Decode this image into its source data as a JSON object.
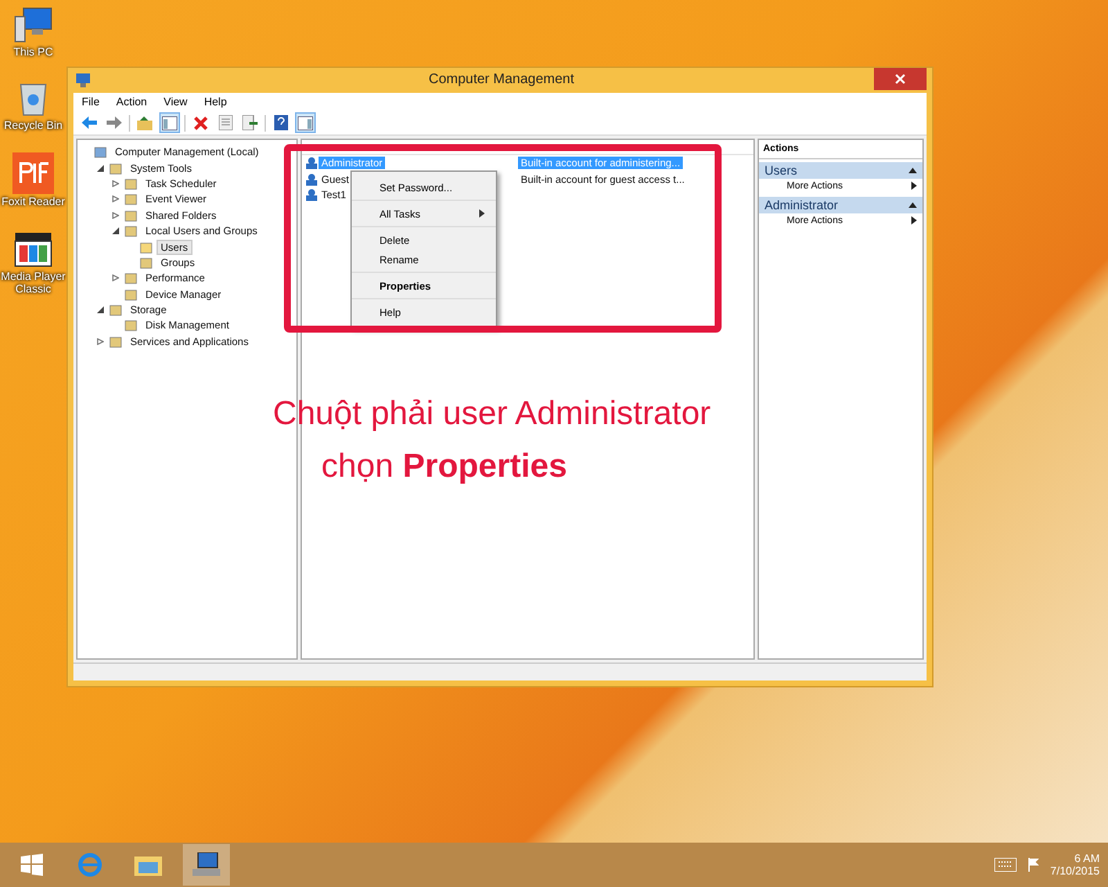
{
  "desktop_icons": [
    {
      "kind": "computer",
      "label": "This PC"
    },
    {
      "kind": "bin",
      "label": "Recycle Bin"
    },
    {
      "kind": "pdf",
      "label": "Foxit Reader"
    },
    {
      "kind": "media",
      "label": "Media Player Classic"
    }
  ],
  "window": {
    "title": "Computer Management",
    "menu": [
      "File",
      "Action",
      "View",
      "Help"
    ],
    "toolbar": [
      {
        "kind": "back",
        "pressed": false
      },
      {
        "kind": "forward",
        "pressed": false
      },
      {
        "kind": "sep",
        "pressed": false
      },
      {
        "kind": "up",
        "pressed": false
      },
      {
        "kind": "tree",
        "pressed": true
      },
      {
        "kind": "sep",
        "pressed": false
      },
      {
        "kind": "delete",
        "pressed": false
      },
      {
        "kind": "props",
        "pressed": false
      },
      {
        "kind": "export",
        "pressed": false
      },
      {
        "kind": "sep",
        "pressed": false
      },
      {
        "kind": "help",
        "pressed": false
      },
      {
        "kind": "pane",
        "pressed": true
      }
    ],
    "tree": [
      {
        "label": "Computer Management (Local)",
        "selected": false,
        "children": [
          {
            "label": "System Tools",
            "expanded": true,
            "selected": false,
            "children": [
              {
                "label": "Task Scheduler",
                "expanded": false,
                "selected": false
              },
              {
                "label": "Event Viewer",
                "expanded": false,
                "selected": false
              },
              {
                "label": "Shared Folders",
                "expanded": false,
                "selected": false
              },
              {
                "label": "Local Users and Groups",
                "expanded": true,
                "selected": false,
                "children": [
                  {
                    "label": "Users",
                    "selected": true
                  },
                  {
                    "label": "Groups",
                    "selected": false
                  }
                ]
              },
              {
                "label": "Performance",
                "expanded": false,
                "selected": false
              },
              {
                "label": "Device Manager",
                "selected": false
              }
            ]
          },
          {
            "label": "Storage",
            "expanded": true,
            "selected": false,
            "children": [
              {
                "label": "Disk Management",
                "selected": false
              }
            ]
          },
          {
            "label": "Services and Applications",
            "expanded": false,
            "selected": false
          }
        ]
      }
    ],
    "users": [
      {
        "name": "Administrator",
        "description": "Built-in account for administering...",
        "selected": true
      },
      {
        "name": "Guest",
        "description": "Built-in account for guest access t...",
        "selected": false
      },
      {
        "name": "Test1",
        "selected": false
      }
    ],
    "context_menu": [
      [
        {
          "label": "Set Password...",
          "bold": false,
          "submenu": false
        }
      ],
      [
        {
          "label": "All Tasks",
          "bold": false,
          "submenu": true
        }
      ],
      [
        {
          "label": "Delete",
          "bold": false,
          "submenu": false
        },
        {
          "label": "Rename",
          "bold": false,
          "submenu": false
        }
      ],
      [
        {
          "label": "Properties",
          "bold": true,
          "submenu": false
        }
      ],
      [
        {
          "label": "Help",
          "bold": false,
          "submenu": false
        }
      ]
    ],
    "actions": {
      "title": "Actions",
      "sections": [
        {
          "title": "Users",
          "item": "More Actions"
        },
        {
          "title": "Administrator",
          "item": "More Actions"
        }
      ]
    }
  },
  "annotation": [
    "Chuột phải user Administrator",
    "chọn **Properties**"
  ],
  "taskbar": {
    "time": "6 AM",
    "date": "7/10/2015"
  }
}
